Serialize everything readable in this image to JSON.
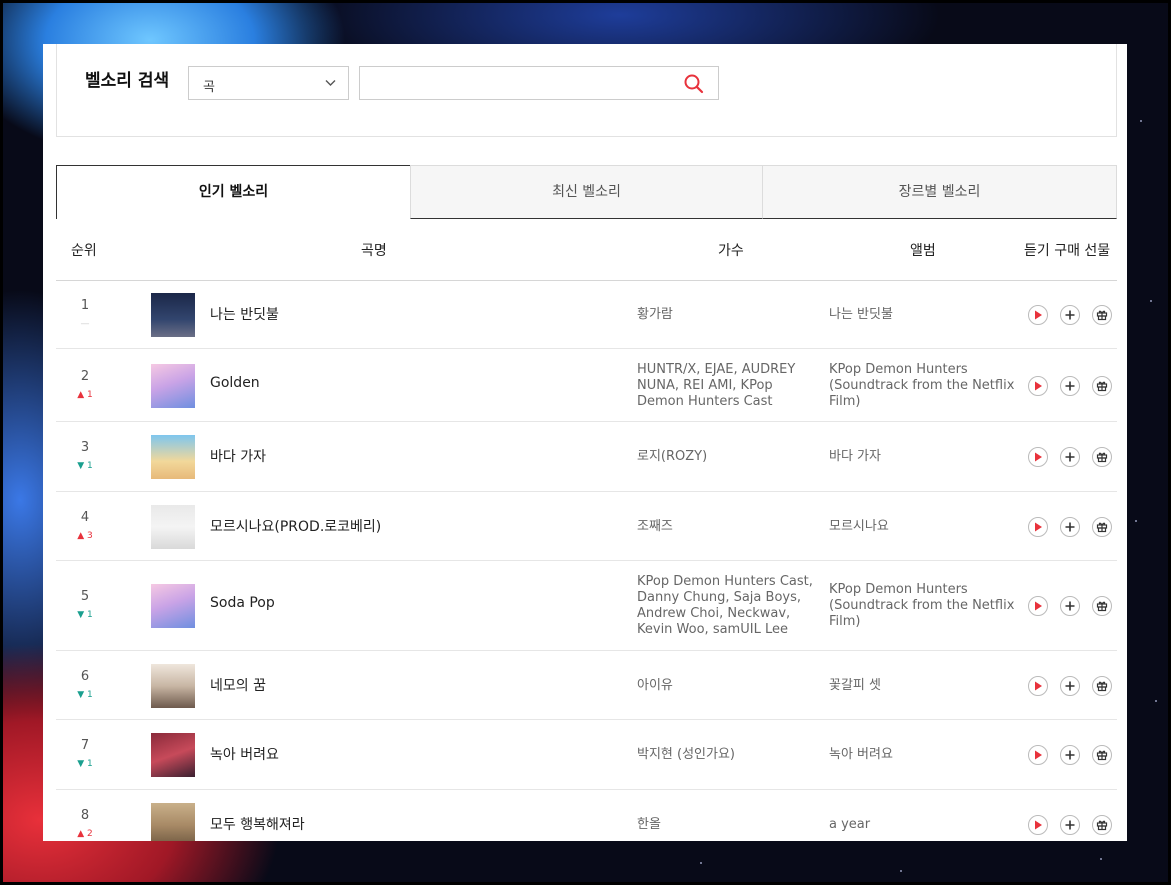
{
  "search": {
    "title": "벨소리 검색",
    "category_selected": "곡",
    "input_value": "",
    "input_placeholder": ""
  },
  "tabs": [
    {
      "label": "인기 벨소리",
      "active": true
    },
    {
      "label": "최신 벨소리",
      "active": false
    },
    {
      "label": "장르별 벨소리",
      "active": false
    }
  ],
  "columns": {
    "rank": "순위",
    "title": "곡명",
    "artist": "가수",
    "album": "앨범",
    "actions": "듣기 구매 선물"
  },
  "rows": [
    {
      "rank": "1",
      "change": "",
      "trend": "same",
      "title": "나는 반딧불",
      "artist": "황가람",
      "album": "나는 반딧불"
    },
    {
      "rank": "2",
      "change": "1",
      "trend": "up",
      "title": "Golden",
      "artist": "HUNTR/X, EJAE, AUDREY NUNA, REI AMI, KPop Demon Hunters Cast",
      "album": "KPop Demon Hunters (Soundtrack from the Netflix Film)"
    },
    {
      "rank": "3",
      "change": "1",
      "trend": "down",
      "title": "바다 가자",
      "artist": "로지(ROZY)",
      "album": "바다 가자"
    },
    {
      "rank": "4",
      "change": "3",
      "trend": "up",
      "title": "모르시나요(PROD.로코베리)",
      "artist": "조째즈",
      "album": "모르시나요"
    },
    {
      "rank": "5",
      "change": "1",
      "trend": "down",
      "title": "Soda Pop",
      "artist": "KPop Demon Hunters Cast, Danny Chung, Saja Boys, Andrew Choi, Neckwav, Kevin Woo, samUIL Lee",
      "album": "KPop Demon Hunters (Soundtrack from the Netflix Film)"
    },
    {
      "rank": "6",
      "change": "1",
      "trend": "down",
      "title": "네모의 꿈",
      "artist": "아이유",
      "album": "꽃갈피 셋"
    },
    {
      "rank": "7",
      "change": "1",
      "trend": "down",
      "title": "녹아 버려요",
      "artist": "박지현 (성인가요)",
      "album": "녹아 버려요"
    },
    {
      "rank": "8",
      "change": "2",
      "trend": "up",
      "title": "모두 행복해져라",
      "artist": "한올",
      "album": "a year"
    }
  ],
  "colors": {
    "accent": "#e8323c",
    "up": "#e8323c",
    "down": "#1a9f8f"
  }
}
